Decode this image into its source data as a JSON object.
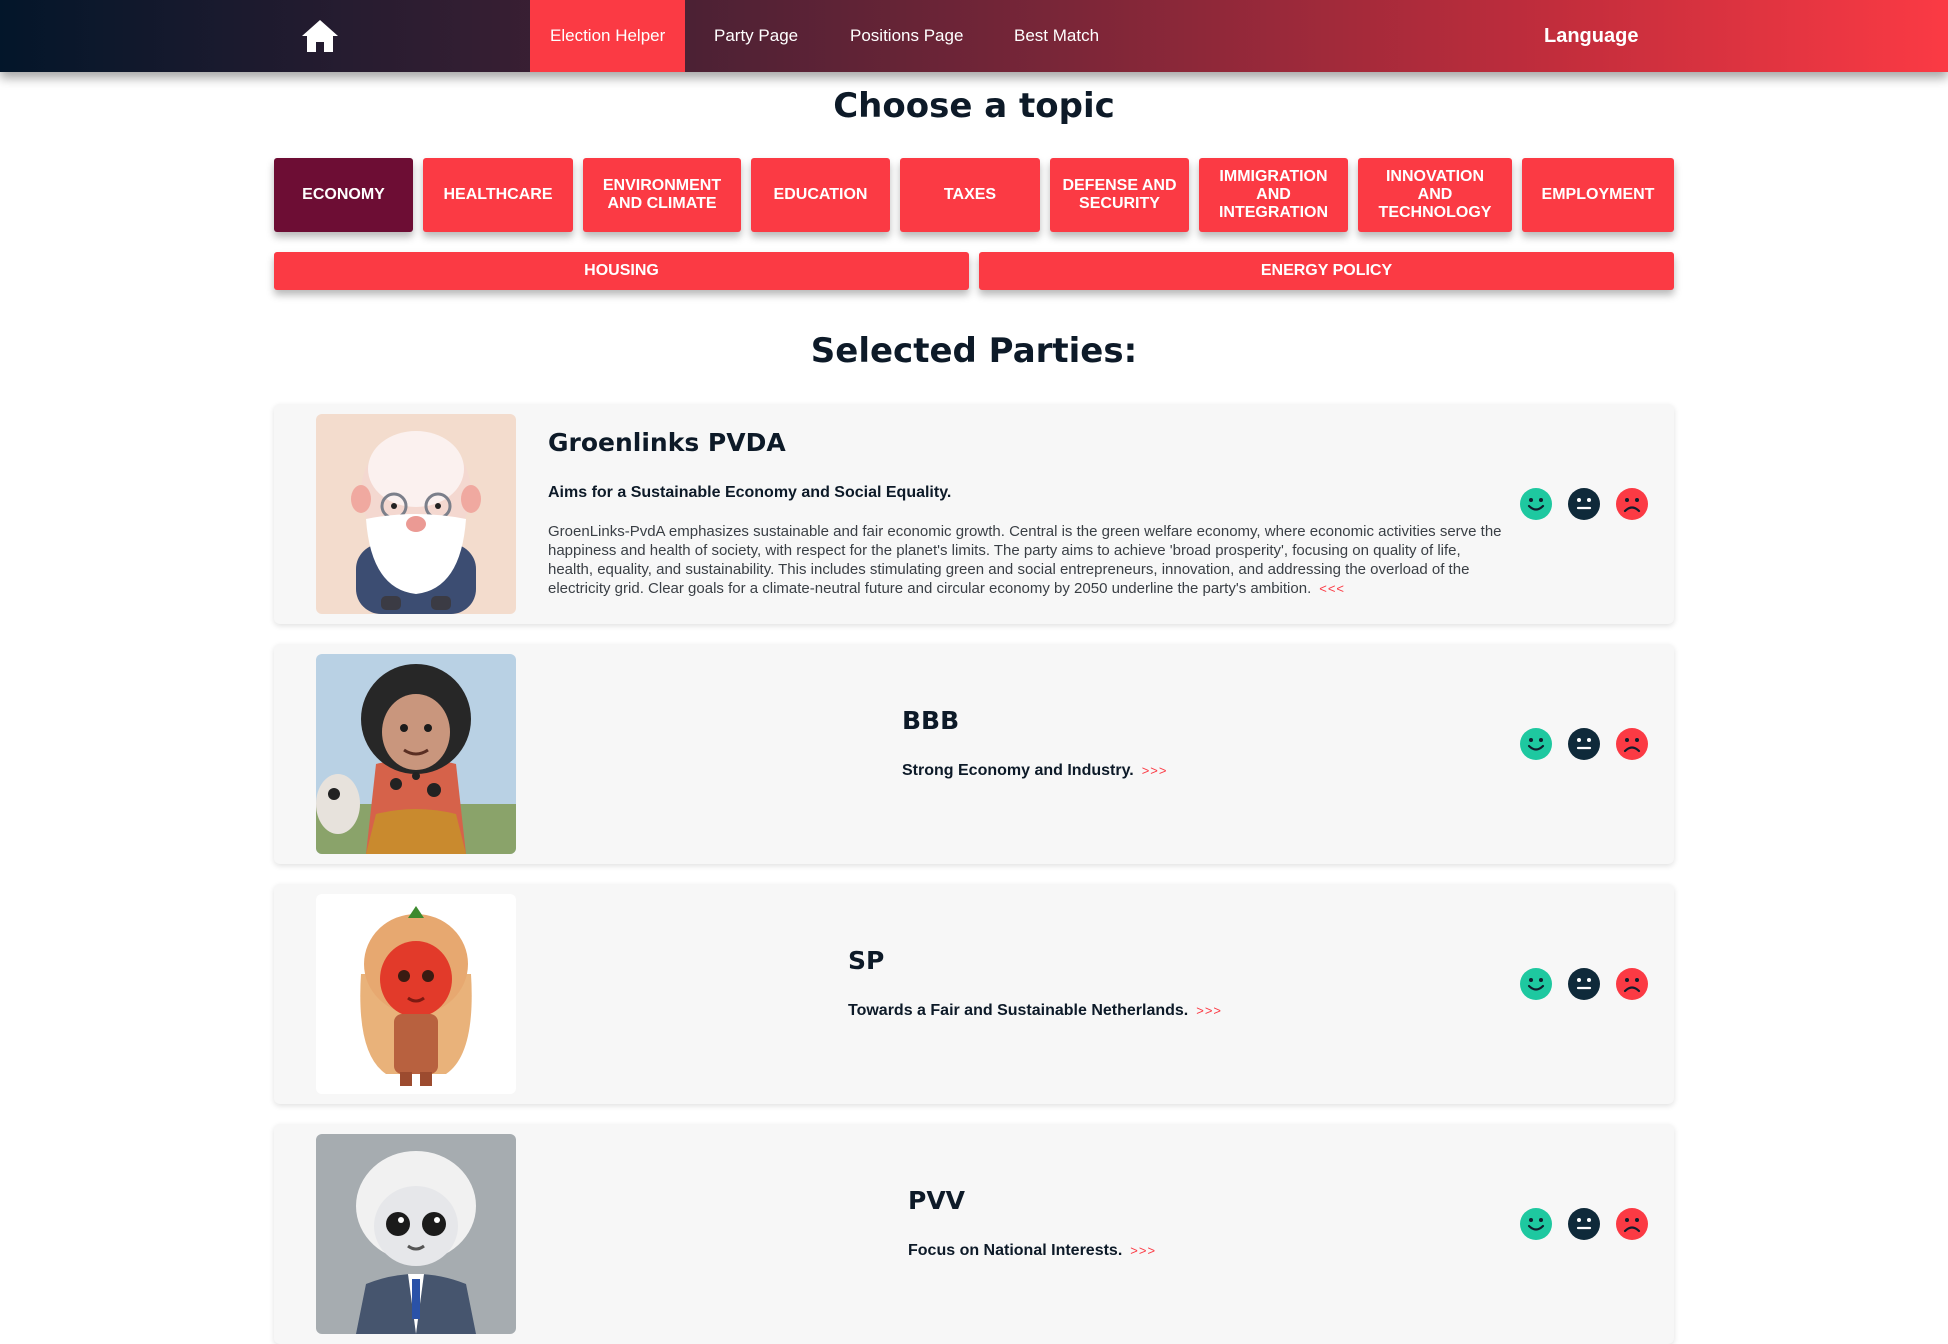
{
  "nav": {
    "links": [
      {
        "label": "Election Helper",
        "active": true
      },
      {
        "label": "Party Page",
        "active": false
      },
      {
        "label": "Positions Page",
        "active": false
      },
      {
        "label": "Best Match",
        "active": false
      }
    ],
    "language_label": "Language"
  },
  "topics": {
    "title": "Choose a topic",
    "items": [
      {
        "label": "Economy",
        "selected": true
      },
      {
        "label": "Healthcare",
        "selected": false
      },
      {
        "label": "Environment and Climate",
        "selected": false
      },
      {
        "label": "Education",
        "selected": false
      },
      {
        "label": "Taxes",
        "selected": false
      },
      {
        "label": "Defense and Security",
        "selected": false
      },
      {
        "label": "Immigration and Integration",
        "selected": false
      },
      {
        "label": "Innovation and Technology",
        "selected": false
      },
      {
        "label": "Employment",
        "selected": false
      },
      {
        "label": "Housing",
        "selected": false
      },
      {
        "label": "Energy Policy",
        "selected": false
      }
    ]
  },
  "parties": {
    "title": "Selected Parties:",
    "items": [
      {
        "name": "Groenlinks PVDA",
        "slogan": "Aims for a Sustainable Economy and Social Equality.",
        "description": "GroenLinks-PvdA emphasizes sustainable and fair economic growth. Central is the green welfare economy, where economic activities serve the happiness and health of society, with respect for the planet's limits. The party aims to achieve 'broad prosperity', focusing on quality of life, health, equality, and sustainability. This includes stimulating green and social entrepreneurs, innovation, and addressing the overload of the electricity grid. Clear goals for a climate-neutral future and circular economy by 2050 underline the party's ambition.",
        "toggle": "<<<",
        "expanded": true
      },
      {
        "name": "BBB",
        "slogan": "Strong Economy and Industry.",
        "toggle": ">>>",
        "expanded": false
      },
      {
        "name": "SP",
        "slogan": "Towards a Fair and Sustainable Netherlands.",
        "toggle": ">>>",
        "expanded": false
      },
      {
        "name": "PVV",
        "slogan": "Focus on National Interests.",
        "toggle": ">>>",
        "expanded": false
      }
    ]
  },
  "reaction_icons": [
    "smile-face-icon",
    "neutral-face-icon",
    "sad-face-icon"
  ],
  "colors": {
    "accent": "#fb3a44",
    "topic_selected": "#6d0d34",
    "reaction_positive": "#1ec8a0",
    "reaction_neutral": "#0f2a3a",
    "reaction_negative": "#fb3a44"
  }
}
